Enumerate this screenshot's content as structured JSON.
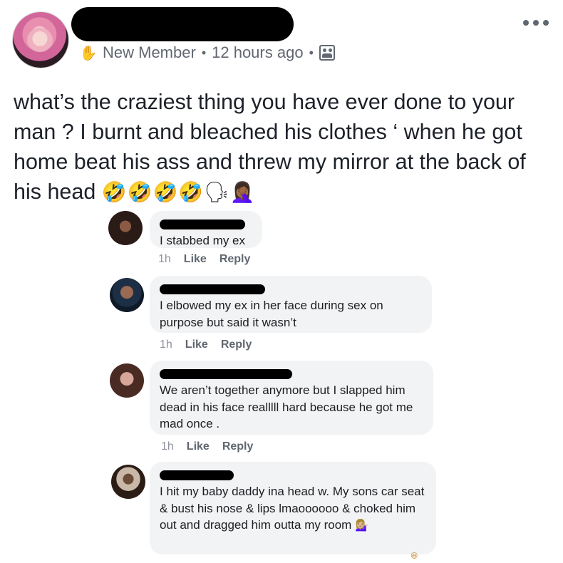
{
  "post": {
    "badge_text": "New Member",
    "separator": "•",
    "timestamp": "12 hours ago",
    "text": "what’s the craziest thing you have ever done to your man ? I burnt and bleached his clothes ‘ when he got home beat his ass and threw my mirror at the back of his head",
    "text_emoji": "🤣🤣🤣🤣🗣🤦🏾‍♀️",
    "icons": [
      "wave-icon",
      "group-icon",
      "more-icon"
    ]
  },
  "comments": [
    {
      "text": "I stabbed my ex",
      "emoji": "",
      "time": "1h",
      "like_label": "Like",
      "reply_label": "Reply"
    },
    {
      "text": "I elbowed my ex in her face during sex on purpose but said it wasn’t",
      "emoji": "",
      "time": "1h",
      "like_label": "Like",
      "reply_label": "Reply"
    },
    {
      "text": "We aren’t together anymore but I slapped him dead in his face realllll hard because he got me mad once .",
      "emoji": "",
      "time": "1h",
      "like_label": "Like",
      "reply_label": "Reply"
    },
    {
      "text": "I hit my baby daddy ina head w. My sons car seat & bust his nose & lips lmaoooooo & choked him out and dragged him outta my room",
      "emoji": "💁🏼‍♀️",
      "time": "",
      "like_label": "",
      "reply_label": ""
    }
  ]
}
